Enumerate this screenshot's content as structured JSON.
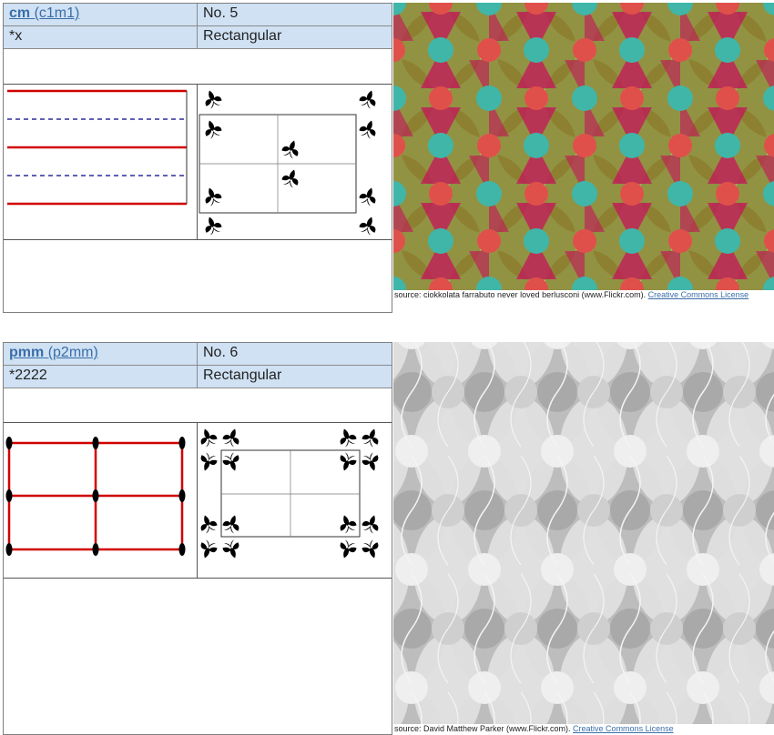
{
  "entries": [
    {
      "name": "cm",
      "alt": "(c1m1)",
      "number": "No. 5",
      "orbifold": "*x",
      "lattice": "Rectangular",
      "source_prefix": "source: ciokkolata farrabuto never loved berlusconi (www.Flickr.com). ",
      "license": "Creative Commons License",
      "colors": {
        "accent": "#d00000",
        "mirror": "#000088",
        "photo_bg": "#a6d88a",
        "petal": "#8a7a2a",
        "disc_red": "#e0504a",
        "disc_teal": "#3fb6a8",
        "magenta": "#c4145a"
      }
    },
    {
      "name": "pmm",
      "alt": "(p2mm)",
      "number": "No. 6",
      "orbifold": "*2222",
      "lattice": "Rectangular",
      "source_prefix": "source: David Matthew Parker (www.Flickr.com). ",
      "license": "Creative Commons License",
      "colors": {
        "accent": "#d00000",
        "photo_bg": "#d6d6d6",
        "dark": "#9e9e9e",
        "light": "#ececec"
      }
    }
  ]
}
